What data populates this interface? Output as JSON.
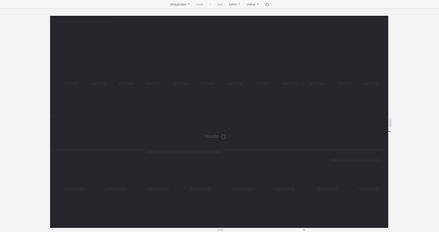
{
  "toolbar": {
    "device": "Responsive",
    "width": "1426",
    "separator": "×",
    "height": "884",
    "zoom": "100%",
    "network": "Online",
    "caret_icon": "chevron-down-icon",
    "rotate_icon": "rotate-icon"
  },
  "viewport": {
    "background": "#26252c",
    "logo_text": "ricette"
  },
  "colors": {
    "toolbar_bg": "#f7f7f8",
    "page_bg": "#f3f3f4"
  }
}
